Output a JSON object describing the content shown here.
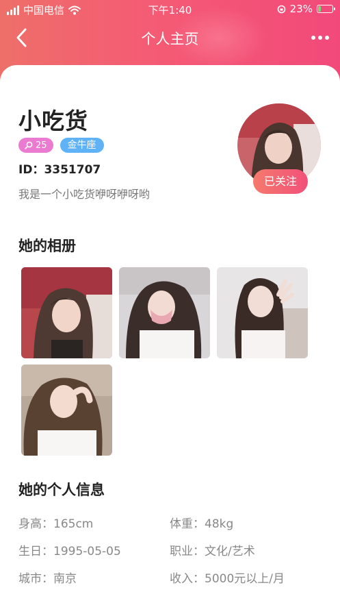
{
  "status_bar": {
    "carrier": "中国电信",
    "time": "下午1:40",
    "battery": "23%",
    "battery_level": 0.23
  },
  "nav": {
    "title": "个人主页"
  },
  "profile": {
    "name": "小吃货",
    "level": "25",
    "zodiac": "金牛座",
    "id_label": "ID：",
    "id_value": "3351707",
    "bio": "我是一个小吃货咿呀咿呀哟",
    "follow_label": "已关注"
  },
  "album": {
    "title": "她的相册"
  },
  "info": {
    "title": "她的个人信息",
    "rows": [
      {
        "label": "身高：",
        "value": "165cm"
      },
      {
        "label": "体重：",
        "value": "48kg"
      },
      {
        "label": "生日：",
        "value": "1995-05-05"
      },
      {
        "label": "职业：",
        "value": "文化/艺术"
      },
      {
        "label": "城市：",
        "value": "南京"
      },
      {
        "label": "收入：",
        "value": "5000元以上/月"
      }
    ]
  },
  "colors": {
    "header_start": "#ee6f69",
    "header_end": "#f2497a",
    "level_tag": "#eb7ad1",
    "zodiac_tag": "#5fb2f6"
  }
}
